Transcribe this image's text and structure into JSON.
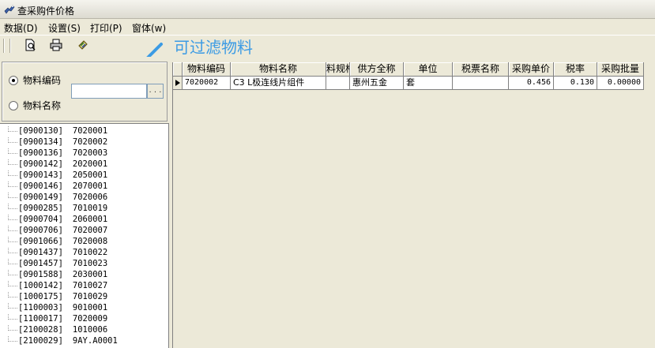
{
  "window": {
    "title": "查采购件价格",
    "app_icon": "bird-app-icon"
  },
  "menu": [
    {
      "label": "数据(D)"
    },
    {
      "label": "设置(S)"
    },
    {
      "label": "打印(P)"
    },
    {
      "label": "窗体(w)"
    }
  ],
  "toolbar": {
    "icons": [
      "preview-icon",
      "print-icon",
      "export-icon"
    ]
  },
  "annotation": {
    "text": "可过滤物料",
    "color": "#3c9be4"
  },
  "filter": {
    "options": [
      {
        "label": "物料编码",
        "selected": true
      },
      {
        "label": "物料名称",
        "selected": false
      }
    ],
    "input_value": "",
    "browse_label": ". . ."
  },
  "tree_items": [
    {
      "code": "[0900130]",
      "id": "7020001"
    },
    {
      "code": "[0900134]",
      "id": "7020002"
    },
    {
      "code": "[0900136]",
      "id": "7020003"
    },
    {
      "code": "[0900142]",
      "id": "2020001"
    },
    {
      "code": "[0900143]",
      "id": "2050001"
    },
    {
      "code": "[0900146]",
      "id": "2070001"
    },
    {
      "code": "[0900149]",
      "id": "7020006"
    },
    {
      "code": "[0900285]",
      "id": "7010019"
    },
    {
      "code": "[0900704]",
      "id": "2060001"
    },
    {
      "code": "[0900706]",
      "id": "7020007"
    },
    {
      "code": "[0901066]",
      "id": "7020008"
    },
    {
      "code": "[0901437]",
      "id": "7010022"
    },
    {
      "code": "[0901457]",
      "id": "7010023"
    },
    {
      "code": "[0901588]",
      "id": "2030001"
    },
    {
      "code": "[1000142]",
      "id": "7010027"
    },
    {
      "code": "[1000175]",
      "id": "7010029"
    },
    {
      "code": "[1100003]",
      "id": "9010001"
    },
    {
      "code": "[1100017]",
      "id": "7020009"
    },
    {
      "code": "[2100028]",
      "id": "1010006"
    },
    {
      "code": "[2100029]",
      "id": "9AY.A0001"
    }
  ],
  "grid": {
    "columns": [
      "物料编码",
      "物料名称",
      "料规格",
      "供方全称",
      "单位",
      "税票名称",
      "采购单价",
      "税率",
      "采购批量"
    ],
    "rows": [
      [
        "7020002",
        "C3 L极连线片组件",
        "",
        "惠州五金",
        "套",
        "",
        "0.456",
        "0.130",
        "0.00000"
      ]
    ]
  }
}
